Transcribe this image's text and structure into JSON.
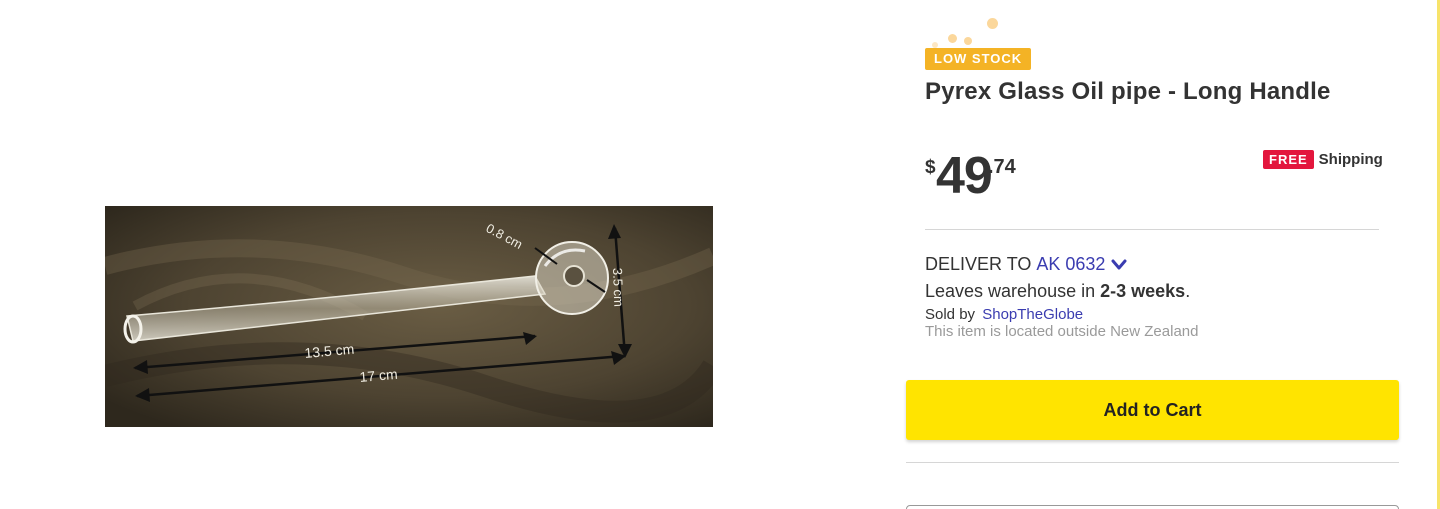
{
  "product": {
    "image_alt": "Pyrex Glass Oil pipe",
    "image_labels": {
      "bowl_width": "0.8 cm",
      "bowl_height": "3.5 cm",
      "shaft_length": "13.5 cm",
      "total_length": "17 cm"
    },
    "stock_badge": "LOW STOCK",
    "title": "Pyrex Glass Oil pipe - Long Handle",
    "price": {
      "currency": "$",
      "whole": "49",
      "cents": ".74"
    },
    "shipping": {
      "badge": "FREE",
      "label": "Shipping"
    }
  },
  "delivery": {
    "prefix": "DELIVER TO",
    "location": "AK 0632",
    "leaves_prefix": "Leaves warehouse in ",
    "leaves_time": "2-3 weeks",
    "leaves_suffix": ".",
    "sold_by_prefix": "Sold by",
    "seller": "ShopTheGlobe",
    "location_note": "This item is located outside New Zealand"
  },
  "actions": {
    "add_to_cart": "Add to Cart"
  },
  "colors": {
    "low_stock": "#f4b325",
    "free_badge": "#e3163d",
    "link": "#3a3cb0",
    "cart_button": "#ffe400"
  }
}
